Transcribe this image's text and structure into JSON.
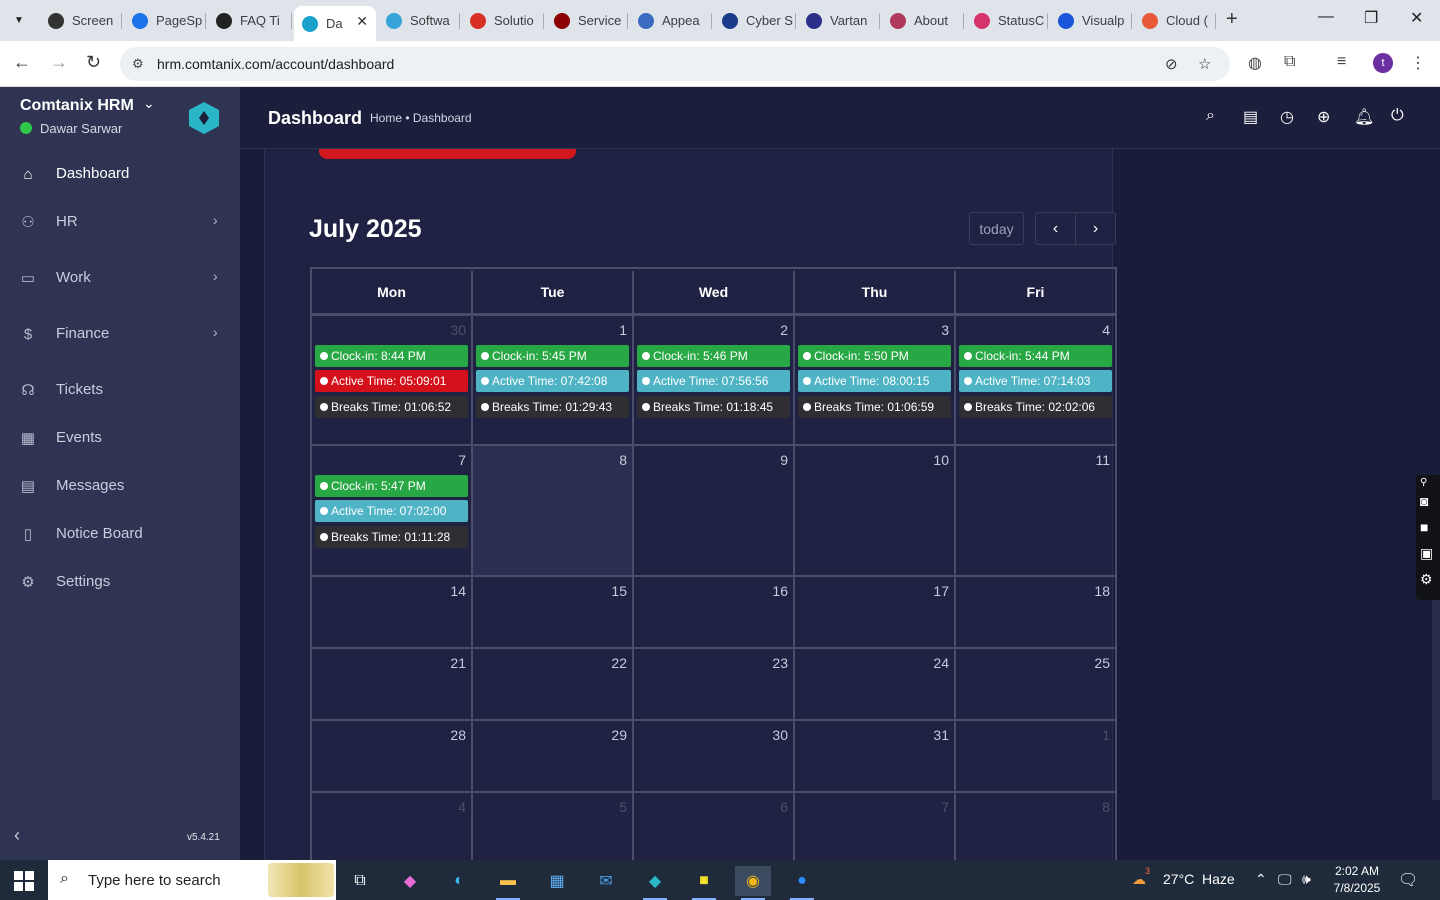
{
  "browser": {
    "tabs": [
      {
        "title": "Screen",
        "color": "#333333"
      },
      {
        "title": "PageSp",
        "color": "#1a73e8"
      },
      {
        "title": "FAQ Ti",
        "color": "#222222"
      },
      {
        "title": "Da",
        "color": "#1aa1c9"
      },
      {
        "title": "Softwa",
        "color": "#36a3d9"
      },
      {
        "title": "Solutio",
        "color": "#d93025"
      },
      {
        "title": "Service",
        "color": "#8b0000"
      },
      {
        "title": "Appea",
        "color": "#3b6bc0"
      },
      {
        "title": "Cyber S",
        "color": "#1a3a8a"
      },
      {
        "title": "Vartan",
        "color": "#2b2f8a"
      },
      {
        "title": "About",
        "color": "#b03a5b"
      },
      {
        "title": "StatusC",
        "color": "#d6336c"
      },
      {
        "title": "Visualp",
        "color": "#1a56db"
      },
      {
        "title": "Cloud (",
        "color": "#e8593a"
      }
    ],
    "url": "hrm.comtanix.com/account/dashboard",
    "profile_initial": "t"
  },
  "sidebar": {
    "brand": "Comtanix HRM",
    "user": "Dawar Sarwar",
    "items": [
      {
        "label": "Dashboard",
        "icon": "home-icon",
        "has_children": false,
        "active": true
      },
      {
        "label": "HR",
        "icon": "users-icon",
        "has_children": true
      },
      {
        "label": "Work",
        "icon": "briefcase-icon",
        "has_children": true
      },
      {
        "label": "Finance",
        "icon": "dollar-icon",
        "has_children": true
      },
      {
        "label": "Tickets",
        "icon": "headset-icon",
        "has_children": false
      },
      {
        "label": "Events",
        "icon": "calendar-icon",
        "has_children": false
      },
      {
        "label": "Messages",
        "icon": "message-icon",
        "has_children": false
      },
      {
        "label": "Notice Board",
        "icon": "clipboard-icon",
        "has_children": false
      },
      {
        "label": "Settings",
        "icon": "gear-icon",
        "has_children": false
      }
    ],
    "version": "v5.4.21"
  },
  "header": {
    "title": "Dashboard",
    "breadcrumb": "Home • Dashboard"
  },
  "calendar": {
    "title": "July 2025",
    "today_label": "today",
    "weekdays": [
      "Mon",
      "Tue",
      "Wed",
      "Thu",
      "Fri"
    ],
    "weeks": [
      {
        "days": [
          {
            "num": "30",
            "other": true,
            "events": [
              {
                "text": "Clock-in: 8:44 PM",
                "type": "green"
              },
              {
                "text": "Active Time: 05:09:01",
                "type": "red"
              },
              {
                "text": "Breaks Time: 01:06:52",
                "type": "dark"
              }
            ]
          },
          {
            "num": "1",
            "events": [
              {
                "text": "Clock-in: 5:45 PM",
                "type": "green"
              },
              {
                "text": "Active Time: 07:42:08",
                "type": "teal"
              },
              {
                "text": "Breaks Time: 01:29:43",
                "type": "dark"
              }
            ]
          },
          {
            "num": "2",
            "events": [
              {
                "text": "Clock-in: 5:46 PM",
                "type": "green"
              },
              {
                "text": "Active Time: 07:56:56",
                "type": "teal"
              },
              {
                "text": "Breaks Time: 01:18:45",
                "type": "dark"
              }
            ]
          },
          {
            "num": "3",
            "events": [
              {
                "text": "Clock-in: 5:50 PM",
                "type": "green"
              },
              {
                "text": "Active Time: 08:00:15",
                "type": "teal"
              },
              {
                "text": "Breaks Time: 01:06:59",
                "type": "dark"
              }
            ]
          },
          {
            "num": "4",
            "events": [
              {
                "text": "Clock-in: 5:44 PM",
                "type": "green"
              },
              {
                "text": "Active Time: 07:14:03",
                "type": "teal"
              },
              {
                "text": "Breaks Time: 02:02:06",
                "type": "dark"
              }
            ]
          }
        ]
      },
      {
        "days": [
          {
            "num": "7",
            "events": [
              {
                "text": "Clock-in: 5:47 PM",
                "type": "green"
              },
              {
                "text": "Active Time: 07:02:00",
                "type": "teal"
              },
              {
                "text": "Breaks Time: 01:11:28",
                "type": "dark"
              }
            ]
          },
          {
            "num": "8",
            "today": true,
            "events": []
          },
          {
            "num": "9",
            "events": []
          },
          {
            "num": "10",
            "events": []
          },
          {
            "num": "11",
            "events": []
          }
        ]
      },
      {
        "days": [
          {
            "num": "14",
            "events": []
          },
          {
            "num": "15",
            "events": []
          },
          {
            "num": "16",
            "events": []
          },
          {
            "num": "17",
            "events": []
          },
          {
            "num": "18",
            "events": []
          }
        ]
      },
      {
        "days": [
          {
            "num": "21",
            "events": []
          },
          {
            "num": "22",
            "events": []
          },
          {
            "num": "23",
            "events": []
          },
          {
            "num": "24",
            "events": []
          },
          {
            "num": "25",
            "events": []
          }
        ]
      },
      {
        "days": [
          {
            "num": "28",
            "events": []
          },
          {
            "num": "29",
            "events": []
          },
          {
            "num": "30",
            "events": []
          },
          {
            "num": "31",
            "events": []
          },
          {
            "num": "1",
            "other": true,
            "events": []
          }
        ]
      },
      {
        "days": [
          {
            "num": "4",
            "other": true,
            "events": []
          },
          {
            "num": "5",
            "other": true,
            "events": []
          },
          {
            "num": "6",
            "other": true,
            "events": []
          },
          {
            "num": "7",
            "other": true,
            "events": []
          },
          {
            "num": "8",
            "other": true,
            "events": []
          }
        ]
      }
    ]
  },
  "taskbar": {
    "search_placeholder": "Type here to search",
    "weather_badge": "3",
    "temperature": "27°C",
    "weather": "Haze",
    "time": "2:02 AM",
    "date": "7/8/2025"
  }
}
